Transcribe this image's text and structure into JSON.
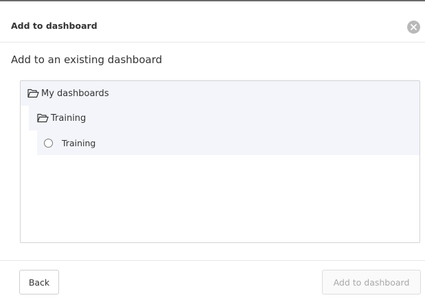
{
  "dialog": {
    "title": "Add to dashboard",
    "close_icon": "close-circle-icon"
  },
  "section": {
    "title": "Add to an existing dashboard"
  },
  "tree": {
    "root": {
      "label": "My dashboards",
      "icon": "folder-open-icon"
    },
    "folder": {
      "label": "Training",
      "icon": "folder-open-icon"
    },
    "item": {
      "label": "Training",
      "selected": false
    }
  },
  "footer": {
    "back_label": "Back",
    "add_label": "Add to dashboard"
  },
  "colors": {
    "row_highlight": "#f3f5fa",
    "close_bg": "#b9b9b9",
    "disabled_text": "#a8a8a8"
  }
}
